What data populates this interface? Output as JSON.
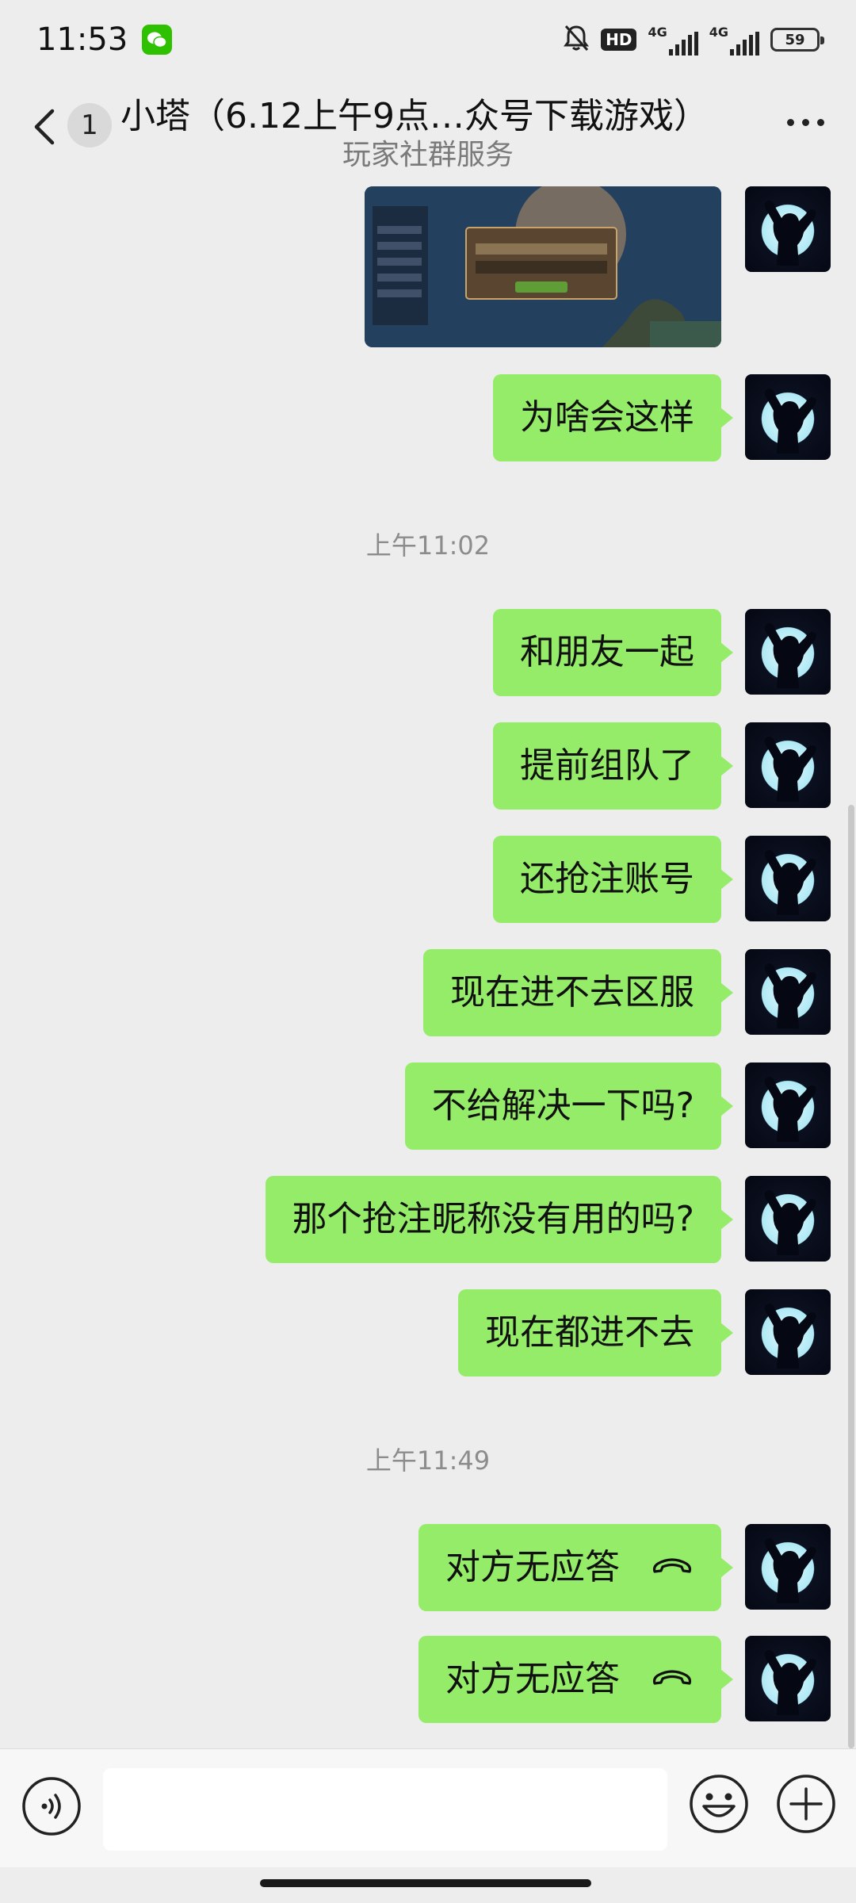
{
  "status_bar": {
    "time": "11:53",
    "hd_label": "HD",
    "network_1": "4G",
    "network_2": "4G",
    "battery": "59"
  },
  "header": {
    "unread_count": "1",
    "title": "小塔（6.12上午9点…众号下载游戏）",
    "subtitle": "玩家社群服务"
  },
  "messages": {
    "m1": "为啥会这样",
    "ts1": "上午11:02",
    "m2": "和朋友一起",
    "m3": "提前组队了",
    "m4": "还抢注账号",
    "m5": "现在进不去区服",
    "m6": "不给解决一下吗?",
    "m7": "那个抢注昵称没有用的吗?",
    "m8": "现在都进不去",
    "ts2": "上午11:49",
    "call1": "对方无应答",
    "call2": "对方无应答"
  },
  "input": {
    "placeholder": ""
  },
  "colors": {
    "bubble": "#95ec69",
    "background": "#ededed",
    "wechat_green": "#2dc100"
  },
  "icons": [
    "back-icon",
    "more-icon",
    "voice-icon",
    "emoji-icon",
    "plus-icon",
    "call-end-icon",
    "mute-bell-icon"
  ]
}
